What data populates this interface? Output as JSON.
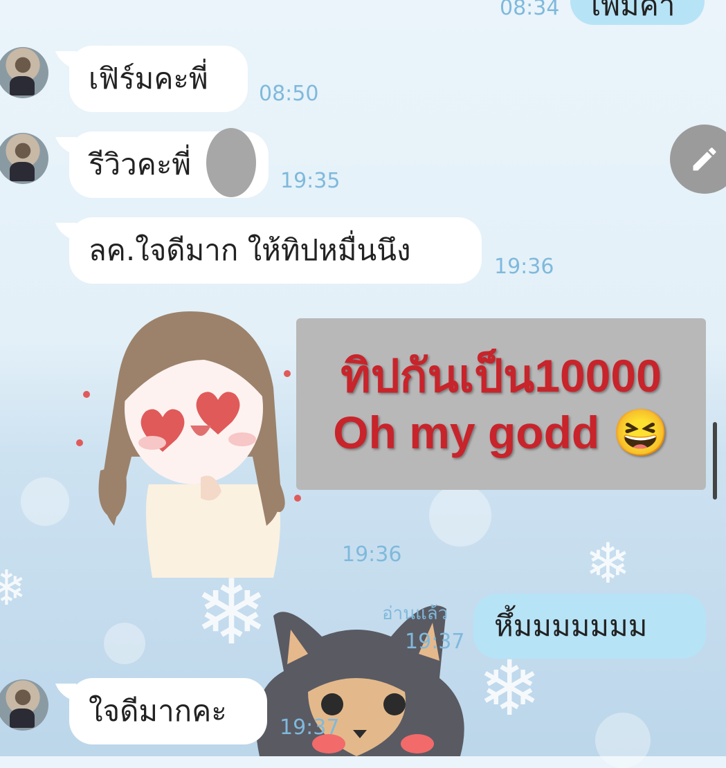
{
  "colors": {
    "incoming_bubble": "#ffffff",
    "outgoing_bubble": "#b7e3f6",
    "timestamp": "#7fb9dc",
    "overlay_bg": "#b8b8b8",
    "overlay_text": "#c8242b"
  },
  "top_partial": {
    "time": "08:34",
    "text": "เพิ่มค่า"
  },
  "messages": [
    {
      "text": "เฟิร์มคะพี่",
      "time": "08:50"
    },
    {
      "text": "รีวิวคะพี่",
      "time": "19:35"
    },
    {
      "text": "ลค.ใจดีมาก ให้ทิปหมื่นนึง",
      "time": "19:36"
    },
    {
      "time": "19:36"
    },
    {
      "text": "หึ้มมมมมมม",
      "read": "อ่านแล้ว",
      "time": "19:37"
    },
    {
      "text": "ใจดีมากคะ",
      "time": "19:37"
    }
  ],
  "overlay": {
    "line1": "ทิปกันเป็น10000",
    "line2": "Oh my godd 😆"
  },
  "icons": {
    "edit": "pencil-icon",
    "sticker1": "anime-girl-heart-eyes-sticker",
    "sticker2": "yorkie-dog-sticker"
  }
}
